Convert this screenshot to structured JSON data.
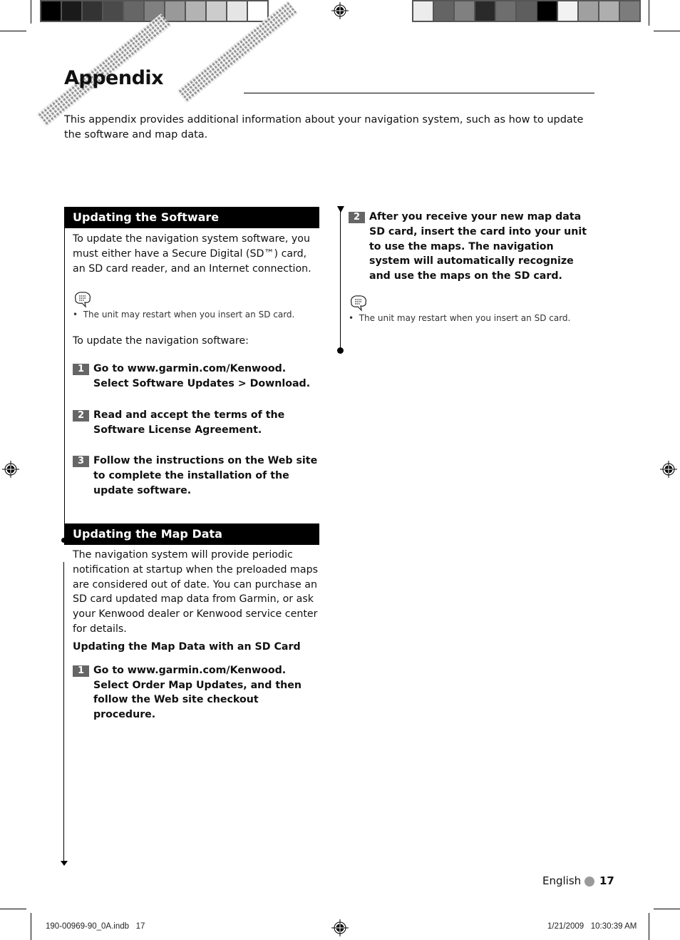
{
  "print_marks": {
    "colorbar_left": [
      "#000000",
      "#1a1a1a",
      "#333333",
      "#4a4a4a",
      "#666666",
      "#808080",
      "#999999",
      "#b3b3b3",
      "#cccccc",
      "#e5e5e5",
      "#ffffff"
    ],
    "colorbar_right": [
      "#ececec",
      "#646464",
      "#808080",
      "#2a2a2a",
      "#6e6e6e",
      "#5e5e5e",
      "#000000",
      "#f2f2f2",
      "#a0a0a0",
      "#aeaeae",
      "#7c7c7c"
    ]
  },
  "page": {
    "title": "Appendix",
    "intro": "This appendix provides additional information about your navigation system, such as how to update the software and map data."
  },
  "software": {
    "heading": "Updating the Software",
    "body": "To update the navigation system software, you must either have a Secure Digital (SD™) card, an SD card reader, and an Internet connection.",
    "note": "The unit may restart when you insert an SD card.",
    "lead": "To update the navigation software:",
    "steps": [
      {
        "num": "1",
        "text": "Go to www.garmin.com/Kenwood. Select Software Updates > Download."
      },
      {
        "num": "2",
        "text": "Read and accept the terms of the Software License Agreement."
      },
      {
        "num": "3",
        "text": "Follow the instructions on the Web site to complete the installation of the update software."
      }
    ]
  },
  "mapdata": {
    "heading": "Updating the Map Data",
    "body": "The navigation system will provide periodic notification at startup when the preloaded maps are considered out of date. You can purchase an SD card updated map data from Garmin, or ask your Kenwood dealer or Kenwood service center for details.",
    "subheading": "Updating the Map Data with an SD Card",
    "steps": [
      {
        "num": "1",
        "text": "Go to www.garmin.com/Kenwood. Select Order Map Updates, and then follow the Web site checkout procedure."
      },
      {
        "num": "2",
        "text": "After you receive your new map data SD card, insert the card into your unit to use the maps. The navigation system will automatically recognize and use the maps on the SD card."
      }
    ],
    "note": "The unit may restart when you insert an SD card."
  },
  "footer": {
    "language": "English",
    "page_number": "17",
    "slug_file": "190-00969-90_0A.indb   17",
    "slug_date": "1/21/2009   10:30:39 AM"
  }
}
